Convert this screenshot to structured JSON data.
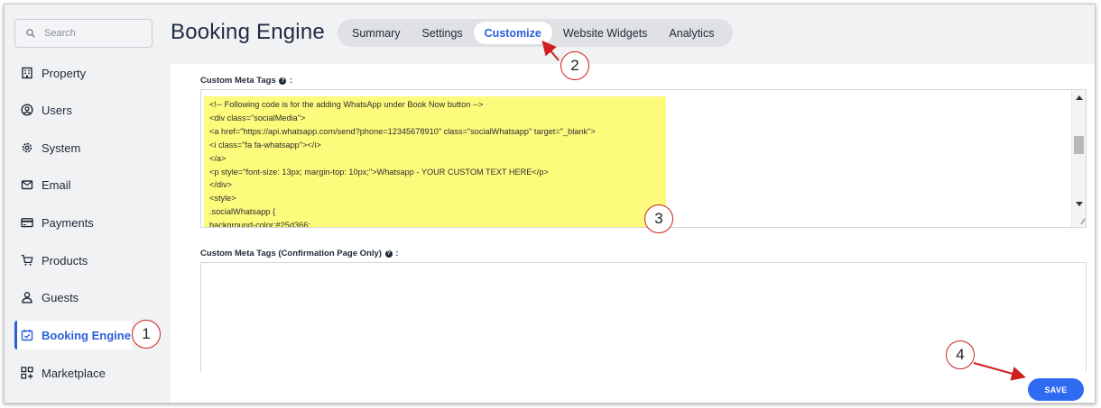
{
  "sidebar": {
    "search_placeholder": "Search",
    "items": [
      {
        "label": "Property",
        "icon": "building-icon"
      },
      {
        "label": "Users",
        "icon": "user-circle-icon"
      },
      {
        "label": "System",
        "icon": "gear-icon"
      },
      {
        "label": "Email",
        "icon": "mail-icon"
      },
      {
        "label": "Payments",
        "icon": "credit-card-icon"
      },
      {
        "label": "Products",
        "icon": "cart-icon"
      },
      {
        "label": "Guests",
        "icon": "person-icon"
      },
      {
        "label": "Booking Engine",
        "icon": "calendar-check-icon",
        "active": true
      },
      {
        "label": "Marketplace",
        "icon": "apps-plus-icon"
      }
    ]
  },
  "header": {
    "title": "Booking Engine",
    "tabs": [
      {
        "label": "Summary"
      },
      {
        "label": "Settings"
      },
      {
        "label": "Customize",
        "active": true
      },
      {
        "label": "Website Widgets"
      },
      {
        "label": "Analytics"
      }
    ]
  },
  "main": {
    "meta_tags_label": "Custom Meta Tags",
    "meta_tags_suffix": ":",
    "meta_tags_code": "<!-- Following code is for the adding WhatsApp under Book Now button -->\n<div class=\"socialMedia\">\n<a href=\"https://api.whatsapp.com/send?phone=12345678910\" class=\"socialWhatsapp\" target=\"_blank\">\n<i class=\"fa fa-whatsapp\"></i>\n</a>\n<p style=\"font-size: 13px; margin-top: 10px;\">Whatsapp - YOUR CUSTOM TEXT HERE</p>\n</div>\n<style>\n.socialWhatsapp {\nbackground-color:#25d366;",
    "confirmation_label": "Custom Meta Tags (Confirmation Page Only)",
    "confirmation_suffix": ":",
    "confirmation_value": "",
    "save_label": "SAVE"
  },
  "annotations": {
    "step1": "1",
    "step2": "2",
    "step3": "3",
    "step4": "4"
  },
  "colors": {
    "accent": "#2b5fd9",
    "save_button": "#2f6bf2",
    "highlight": "#fdfb7c",
    "callout_border": "#cf1f1f"
  }
}
